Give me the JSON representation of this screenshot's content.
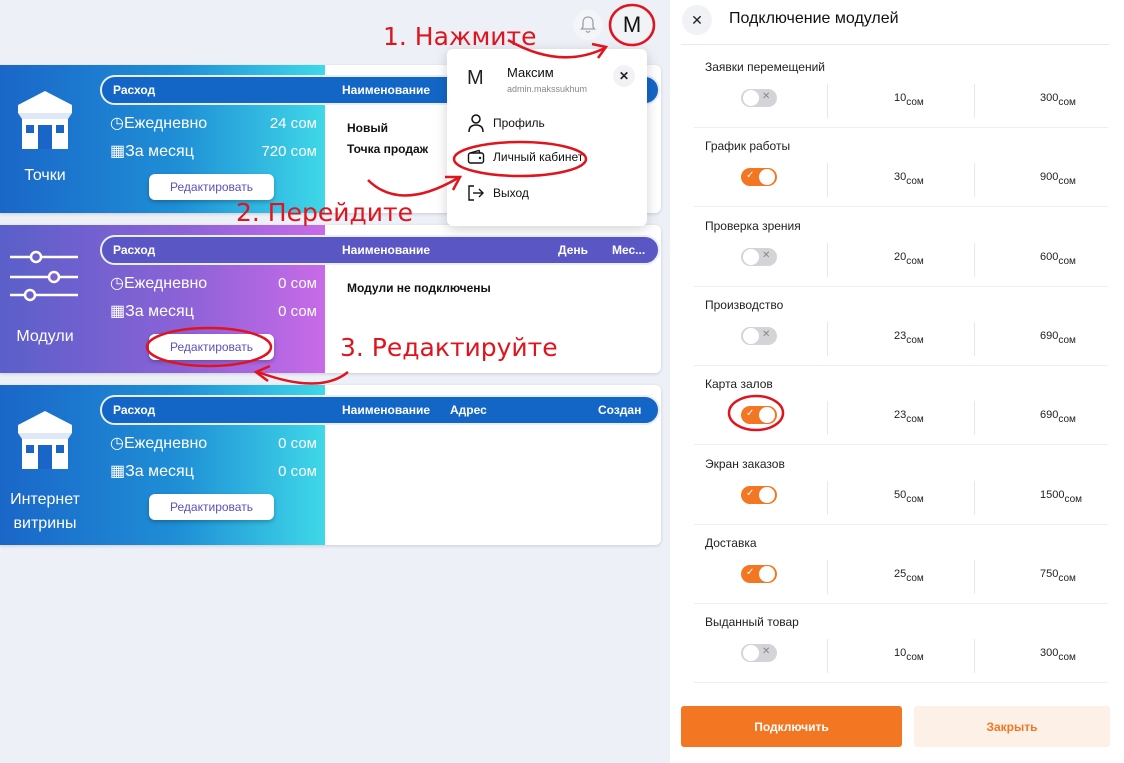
{
  "topbar": {
    "avatar_letter": "M"
  },
  "cards": [
    {
      "label": "Точки",
      "header": {
        "col1": "Расход",
        "col2": "Наименование"
      },
      "daily_label": "Ежедневно",
      "daily_value": "24 сом",
      "monthly_label": "За месяц",
      "monthly_value": "720 сом",
      "edit": "Редактировать",
      "rows": [
        "Новый",
        "Точка продаж"
      ]
    },
    {
      "label": "Модули",
      "header": {
        "col1": "Расход",
        "col2": "Наименование",
        "col3": "День",
        "col4": "Мес..."
      },
      "daily_label": "Ежедневно",
      "daily_value": "0 сом",
      "monthly_label": "За месяц",
      "monthly_value": "0 сом",
      "edit": "Редактировать",
      "empty": "Модули не подключены"
    },
    {
      "label_line1": "Интернет",
      "label_line2": "витрины",
      "header": {
        "col1": "Расход",
        "col2": "Наименование",
        "col3": "Адрес",
        "col4": "Создан"
      },
      "daily_label": "Ежедневно",
      "daily_value": "0 сом",
      "monthly_label": "За месяц",
      "monthly_value": "0 сом",
      "edit": "Редактировать"
    }
  ],
  "dropdown": {
    "avatar_letter": "M",
    "name": "Максим",
    "login": "admin.makssukhum",
    "items": [
      "Профиль",
      "Личный кабинет",
      "Выход"
    ]
  },
  "panel": {
    "title": "Подключение модулей",
    "currency": "сом",
    "modules": [
      {
        "name": "Заявки перемещений",
        "enabled": false,
        "day": "10",
        "month": "300"
      },
      {
        "name": "График работы",
        "enabled": true,
        "day": "30",
        "month": "900"
      },
      {
        "name": "Проверка зрения",
        "enabled": false,
        "day": "20",
        "month": "600"
      },
      {
        "name": "Производство",
        "enabled": false,
        "day": "23",
        "month": "690"
      },
      {
        "name": "Карта залов",
        "enabled": true,
        "day": "23",
        "month": "690"
      },
      {
        "name": "Экран заказов",
        "enabled": true,
        "day": "50",
        "month": "1500"
      },
      {
        "name": "Доставка",
        "enabled": true,
        "day": "25",
        "month": "750"
      },
      {
        "name": "Выданный товар",
        "enabled": false,
        "day": "10",
        "month": "300"
      }
    ],
    "connect": "Подключить",
    "close": "Закрыть"
  },
  "annotations": {
    "step1": "1. Нажмите",
    "step2": "2. Перейдите",
    "step3": "3. Редактируйте",
    "color": "#e0141e"
  }
}
